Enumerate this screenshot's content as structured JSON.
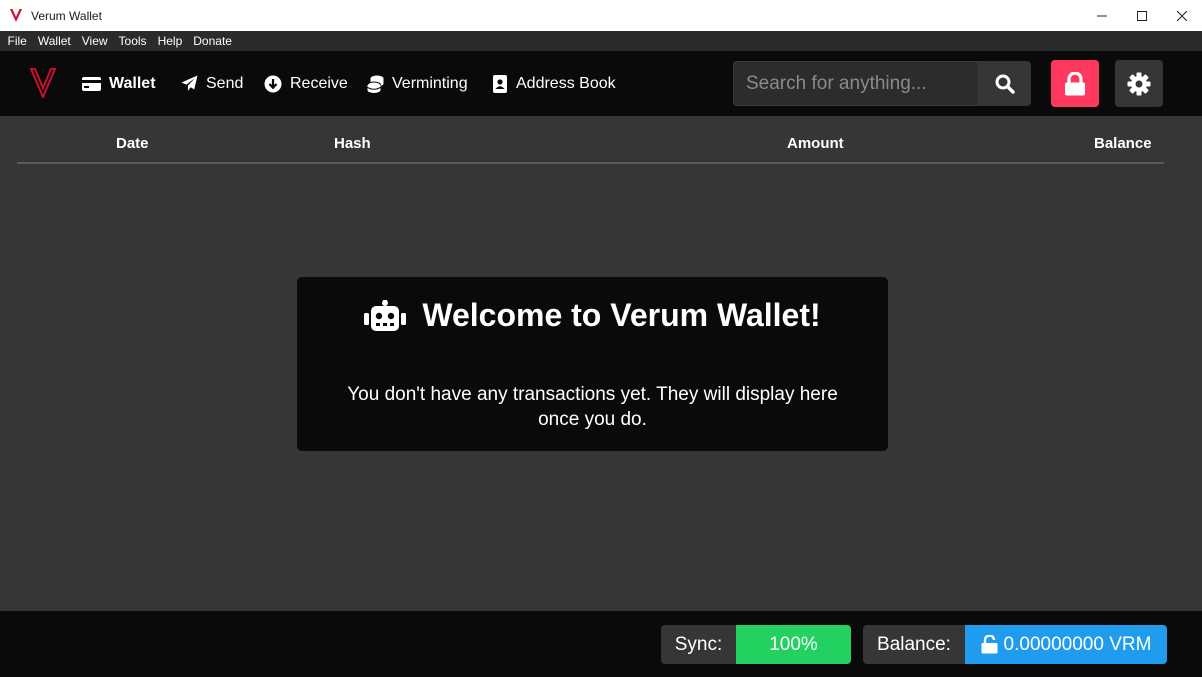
{
  "window": {
    "title": "Verum Wallet"
  },
  "menubar": {
    "items": [
      "File",
      "Wallet",
      "View",
      "Tools",
      "Help",
      "Donate"
    ]
  },
  "nav": {
    "items": [
      {
        "label": "Wallet",
        "icon": "wallet-icon",
        "active": true
      },
      {
        "label": "Send",
        "icon": "paper-plane-icon",
        "active": false
      },
      {
        "label": "Receive",
        "icon": "arrow-circle-down-icon",
        "active": false
      },
      {
        "label": "Verminting",
        "icon": "coins-icon",
        "active": false
      },
      {
        "label": "Address Book",
        "icon": "address-book-icon",
        "active": false
      }
    ],
    "search_placeholder": "Search for anything..."
  },
  "table": {
    "columns": [
      "Date",
      "Hash",
      "Amount",
      "Balance"
    ]
  },
  "welcome": {
    "title": "Welcome to Verum Wallet!",
    "message": "You don't have any transactions yet. They will display here once you do."
  },
  "footer": {
    "sync_label": "Sync:",
    "sync_value": "100%",
    "balance_label": "Balance:",
    "balance_value": "0.00000000 VRM"
  },
  "colors": {
    "brand": "#c8102e",
    "lock_button": "#ff3860",
    "sync_badge": "#23d160",
    "balance_badge": "#209cee"
  }
}
